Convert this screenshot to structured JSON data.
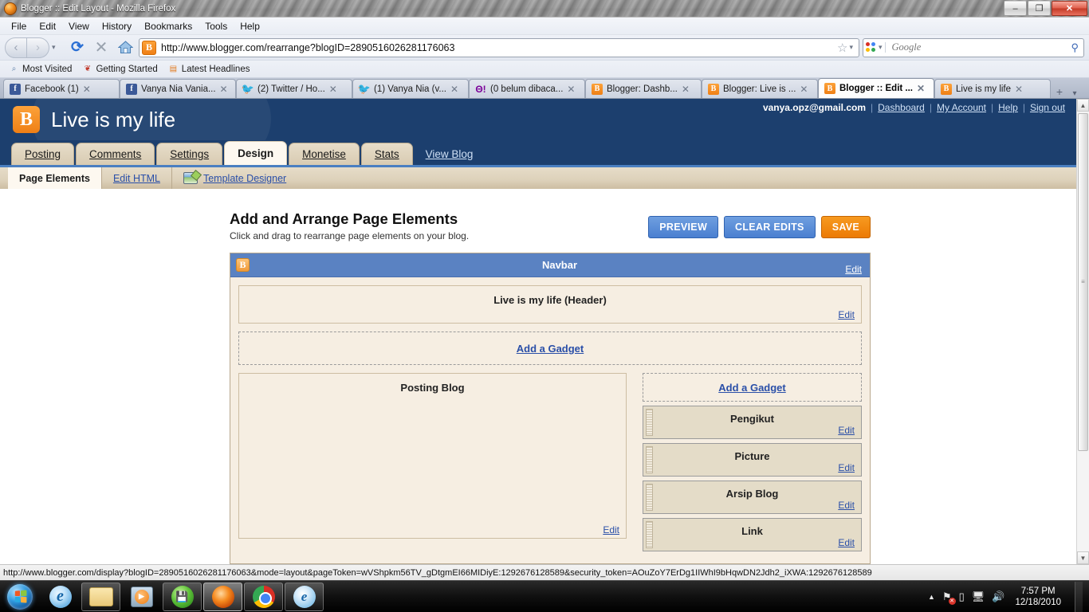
{
  "window": {
    "title": "Blogger :: Edit Layout - Mozilla Firefox",
    "minimize": "–",
    "maximize": "❐",
    "close": "✕"
  },
  "menubar": {
    "items": [
      "File",
      "Edit",
      "View",
      "History",
      "Bookmarks",
      "Tools",
      "Help"
    ]
  },
  "toolbar": {
    "back_icon": "‹",
    "forward_icon": "›",
    "dropdown_icon": "▾",
    "reload_icon": "⟳",
    "stop_icon": "✕",
    "home_icon": "⌂",
    "url": "http://www.blogger.com/rearrange?blogID=2890516026281176063",
    "favicon_letter": "B",
    "star_icon": "☆",
    "search_engine": "Google",
    "search_placeholder": "Google",
    "search_icon": "⚲"
  },
  "bookmarks": {
    "items": [
      {
        "label": "Most Visited",
        "icon": "⌕"
      },
      {
        "label": "Getting Started",
        "icon": "❦"
      },
      {
        "label": "Latest Headlines",
        "icon": "▤"
      }
    ]
  },
  "tabs": {
    "items": [
      {
        "label": "Facebook (1)",
        "type": "fb",
        "glyph": "f",
        "active": false
      },
      {
        "label": "Vanya Nia Vania...",
        "type": "fb",
        "glyph": "f",
        "active": false
      },
      {
        "label": "(2) Twitter / Ho...",
        "type": "tw",
        "glyph": "🐦",
        "active": false
      },
      {
        "label": "(1) Vanya Nia (v...",
        "type": "tw",
        "glyph": "🐦",
        "active": false
      },
      {
        "label": "(0 belum dibaca...",
        "type": "ym",
        "glyph": "Θ!",
        "active": false
      },
      {
        "label": "Blogger: Dashb...",
        "type": "bl",
        "glyph": "B",
        "active": false
      },
      {
        "label": "Blogger: Live is ...",
        "type": "bl",
        "glyph": "B",
        "active": false
      },
      {
        "label": "Blogger :: Edit ...",
        "type": "bl",
        "glyph": "B",
        "active": true
      },
      {
        "label": "Live is my life",
        "type": "bl",
        "glyph": "B",
        "active": false
      }
    ],
    "close_icon": "✕",
    "new_tab_icon": "+",
    "list_all_icon": "▾"
  },
  "blogger": {
    "logo_letter": "B",
    "blog_title": "Live is my life",
    "account": {
      "email": "vanya.opz@gmail.com",
      "links": [
        "Dashboard",
        "My Account",
        "Help",
        "Sign out"
      ],
      "separator": "|"
    },
    "nav_tabs": [
      {
        "label": "Posting",
        "active": false
      },
      {
        "label": "Comments",
        "active": false
      },
      {
        "label": "Settings",
        "active": false
      },
      {
        "label": "Design",
        "active": true
      },
      {
        "label": "Monetise",
        "active": false
      },
      {
        "label": "Stats",
        "active": false
      }
    ],
    "view_blog": "View Blog",
    "subnav": [
      {
        "label": "Page Elements",
        "active": true,
        "icon": null
      },
      {
        "label": "Edit HTML",
        "active": false,
        "icon": null
      },
      {
        "label": "Template Designer",
        "active": false,
        "icon": "template-designer-icon"
      }
    ]
  },
  "main": {
    "title": "Add and Arrange Page Elements",
    "subtitle": "Click and drag to rearrange page elements on your blog.",
    "buttons": [
      {
        "label": "PREVIEW",
        "style": "blue"
      },
      {
        "label": "CLEAR EDITS",
        "style": "blue"
      },
      {
        "label": "SAVE",
        "style": "orange"
      }
    ],
    "edit_label": "Edit",
    "add_gadget_label": "Add a Gadget",
    "navbar_section": {
      "label": "Navbar",
      "edit": "Edit"
    },
    "header_section": {
      "label": "Live is my life (Header)",
      "edit": "Edit"
    },
    "main_column": {
      "label": "Posting Blog",
      "edit": "Edit"
    },
    "sidebar_gadgets": [
      {
        "label": "Pengikut",
        "edit": "Edit"
      },
      {
        "label": "Picture",
        "edit": "Edit"
      },
      {
        "label": "Arsip Blog",
        "edit": "Edit"
      },
      {
        "label": "Link",
        "edit": "Edit"
      }
    ]
  },
  "statusbar": {
    "text": "http://www.blogger.com/display?blogID=2890516026281176063&mode=layout&pageToken=wVShpkm56TV_gDtgmEI66MIDiyE:1292676128589&security_token=AOuZoY7ErDg1IIWhI9bHqwDN2Jdh2_iXWA:1292676128589"
  },
  "scrollbar": {
    "up_icon": "▲",
    "down_icon": "▼",
    "grip_icon": "≡"
  },
  "taskbar": {
    "start_label": "Start",
    "items": [
      {
        "name": "internet-explorer",
        "state": "pinned"
      },
      {
        "name": "windows-explorer",
        "state": "pinned"
      },
      {
        "name": "windows-media-player",
        "state": "pinned"
      },
      {
        "name": "green-app",
        "state": "open"
      },
      {
        "name": "firefox",
        "state": "active"
      },
      {
        "name": "google-chrome",
        "state": "open"
      },
      {
        "name": "internet-explorer-window",
        "state": "open"
      }
    ],
    "tray": {
      "show_hidden_icon": "▲",
      "network_icon": "⚑",
      "battery_icon": "▯",
      "action_center_icon": "⚑",
      "volume_icon": "🔊",
      "time": "7:57 PM",
      "date": "12/18/2010"
    }
  },
  "colors": {
    "blogger_dark": "#1c3f6e",
    "blogger_accent": "#4a7fc1",
    "navbar_section_blue": "#5a82c2",
    "orange": "#ec7a04",
    "link_blue": "#2a4fa8",
    "panel_beige": "#f6eee2",
    "gadget_beige": "#e4dcc8"
  }
}
